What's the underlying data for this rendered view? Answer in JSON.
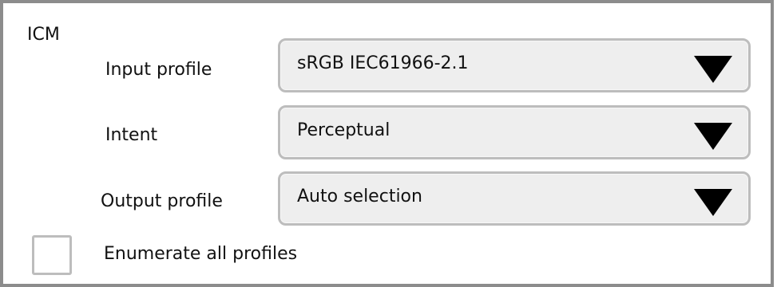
{
  "group": {
    "title": "ICM"
  },
  "fields": [
    {
      "label": "Input profile",
      "value": "sRGB IEC61966-2.1",
      "icon": "dropdown-arrow-icon"
    },
    {
      "label": "Intent",
      "value": "Perceptual",
      "icon": "dropdown-arrow-icon"
    },
    {
      "label": "Output profile",
      "value": "Auto selection",
      "icon": "dropdown-arrow-icon"
    }
  ],
  "checkbox": {
    "label": "Enumerate all profiles",
    "checked": false
  }
}
